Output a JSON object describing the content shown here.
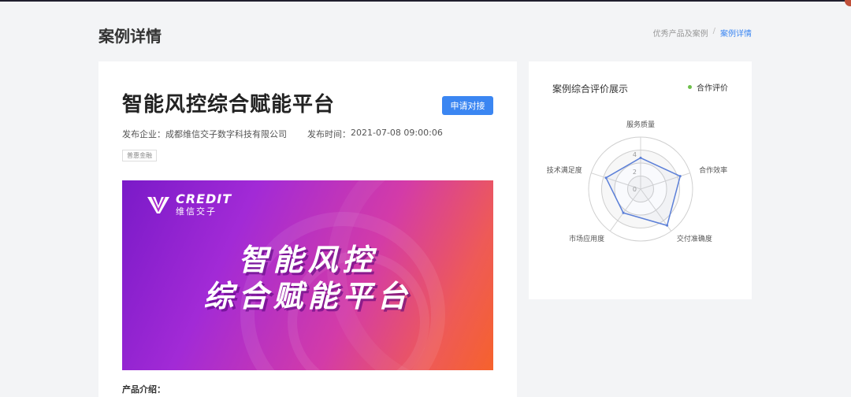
{
  "page": {
    "title": "案例详情",
    "breadcrumb": {
      "parent": "优秀产品及案例",
      "separator": "/",
      "current": "案例详情"
    }
  },
  "case": {
    "title": "智能风控综合赋能平台",
    "apply_button": "申请对接",
    "publisher_label": "发布企业：",
    "publisher": "成都维信交子数字科技有限公司",
    "time_label": "发布时间：",
    "time": "2021-07-08 09:00:06",
    "tag": "普惠金融",
    "banner": {
      "logo_en": "CREDIT",
      "logo_cn": "维信交子",
      "line1": "智能风控",
      "line2": "综合赋能平台"
    },
    "intro_label": "产品介绍："
  },
  "evaluation": {
    "title": "案例综合评价展示",
    "legend": "合作评价",
    "colors": {
      "series": "#5b7fd8",
      "legend": "#6ec04b",
      "primary": "#3b86f2"
    }
  },
  "chart_data": {
    "type": "radar",
    "axes": [
      "服务质量",
      "合作效率",
      "交付准确度",
      "市场应用度",
      "技术满足度"
    ],
    "ticks": [
      "0",
      "2",
      "4"
    ],
    "rmax": 6,
    "series": [
      {
        "name": "合作评价",
        "values": [
          3.6,
          4.8,
          5.2,
          3.4,
          4.2
        ]
      }
    ]
  }
}
